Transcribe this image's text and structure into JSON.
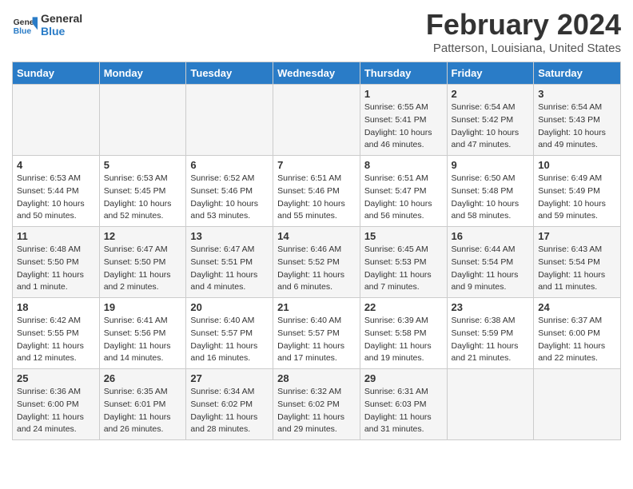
{
  "header": {
    "logo_line1": "General",
    "logo_line2": "Blue",
    "month": "February 2024",
    "location": "Patterson, Louisiana, United States"
  },
  "days_of_week": [
    "Sunday",
    "Monday",
    "Tuesday",
    "Wednesday",
    "Thursday",
    "Friday",
    "Saturday"
  ],
  "weeks": [
    [
      {
        "day": "",
        "sunrise": "",
        "sunset": "",
        "daylight": ""
      },
      {
        "day": "",
        "sunrise": "",
        "sunset": "",
        "daylight": ""
      },
      {
        "day": "",
        "sunrise": "",
        "sunset": "",
        "daylight": ""
      },
      {
        "day": "",
        "sunrise": "",
        "sunset": "",
        "daylight": ""
      },
      {
        "day": "1",
        "sunrise": "Sunrise: 6:55 AM",
        "sunset": "Sunset: 5:41 PM",
        "daylight": "Daylight: 10 hours and 46 minutes."
      },
      {
        "day": "2",
        "sunrise": "Sunrise: 6:54 AM",
        "sunset": "Sunset: 5:42 PM",
        "daylight": "Daylight: 10 hours and 47 minutes."
      },
      {
        "day": "3",
        "sunrise": "Sunrise: 6:54 AM",
        "sunset": "Sunset: 5:43 PM",
        "daylight": "Daylight: 10 hours and 49 minutes."
      }
    ],
    [
      {
        "day": "4",
        "sunrise": "Sunrise: 6:53 AM",
        "sunset": "Sunset: 5:44 PM",
        "daylight": "Daylight: 10 hours and 50 minutes."
      },
      {
        "day": "5",
        "sunrise": "Sunrise: 6:53 AM",
        "sunset": "Sunset: 5:45 PM",
        "daylight": "Daylight: 10 hours and 52 minutes."
      },
      {
        "day": "6",
        "sunrise": "Sunrise: 6:52 AM",
        "sunset": "Sunset: 5:46 PM",
        "daylight": "Daylight: 10 hours and 53 minutes."
      },
      {
        "day": "7",
        "sunrise": "Sunrise: 6:51 AM",
        "sunset": "Sunset: 5:46 PM",
        "daylight": "Daylight: 10 hours and 55 minutes."
      },
      {
        "day": "8",
        "sunrise": "Sunrise: 6:51 AM",
        "sunset": "Sunset: 5:47 PM",
        "daylight": "Daylight: 10 hours and 56 minutes."
      },
      {
        "day": "9",
        "sunrise": "Sunrise: 6:50 AM",
        "sunset": "Sunset: 5:48 PM",
        "daylight": "Daylight: 10 hours and 58 minutes."
      },
      {
        "day": "10",
        "sunrise": "Sunrise: 6:49 AM",
        "sunset": "Sunset: 5:49 PM",
        "daylight": "Daylight: 10 hours and 59 minutes."
      }
    ],
    [
      {
        "day": "11",
        "sunrise": "Sunrise: 6:48 AM",
        "sunset": "Sunset: 5:50 PM",
        "daylight": "Daylight: 11 hours and 1 minute."
      },
      {
        "day": "12",
        "sunrise": "Sunrise: 6:47 AM",
        "sunset": "Sunset: 5:50 PM",
        "daylight": "Daylight: 11 hours and 2 minutes."
      },
      {
        "day": "13",
        "sunrise": "Sunrise: 6:47 AM",
        "sunset": "Sunset: 5:51 PM",
        "daylight": "Daylight: 11 hours and 4 minutes."
      },
      {
        "day": "14",
        "sunrise": "Sunrise: 6:46 AM",
        "sunset": "Sunset: 5:52 PM",
        "daylight": "Daylight: 11 hours and 6 minutes."
      },
      {
        "day": "15",
        "sunrise": "Sunrise: 6:45 AM",
        "sunset": "Sunset: 5:53 PM",
        "daylight": "Daylight: 11 hours and 7 minutes."
      },
      {
        "day": "16",
        "sunrise": "Sunrise: 6:44 AM",
        "sunset": "Sunset: 5:54 PM",
        "daylight": "Daylight: 11 hours and 9 minutes."
      },
      {
        "day": "17",
        "sunrise": "Sunrise: 6:43 AM",
        "sunset": "Sunset: 5:54 PM",
        "daylight": "Daylight: 11 hours and 11 minutes."
      }
    ],
    [
      {
        "day": "18",
        "sunrise": "Sunrise: 6:42 AM",
        "sunset": "Sunset: 5:55 PM",
        "daylight": "Daylight: 11 hours and 12 minutes."
      },
      {
        "day": "19",
        "sunrise": "Sunrise: 6:41 AM",
        "sunset": "Sunset: 5:56 PM",
        "daylight": "Daylight: 11 hours and 14 minutes."
      },
      {
        "day": "20",
        "sunrise": "Sunrise: 6:40 AM",
        "sunset": "Sunset: 5:57 PM",
        "daylight": "Daylight: 11 hours and 16 minutes."
      },
      {
        "day": "21",
        "sunrise": "Sunrise: 6:40 AM",
        "sunset": "Sunset: 5:57 PM",
        "daylight": "Daylight: 11 hours and 17 minutes."
      },
      {
        "day": "22",
        "sunrise": "Sunrise: 6:39 AM",
        "sunset": "Sunset: 5:58 PM",
        "daylight": "Daylight: 11 hours and 19 minutes."
      },
      {
        "day": "23",
        "sunrise": "Sunrise: 6:38 AM",
        "sunset": "Sunset: 5:59 PM",
        "daylight": "Daylight: 11 hours and 21 minutes."
      },
      {
        "day": "24",
        "sunrise": "Sunrise: 6:37 AM",
        "sunset": "Sunset: 6:00 PM",
        "daylight": "Daylight: 11 hours and 22 minutes."
      }
    ],
    [
      {
        "day": "25",
        "sunrise": "Sunrise: 6:36 AM",
        "sunset": "Sunset: 6:00 PM",
        "daylight": "Daylight: 11 hours and 24 minutes."
      },
      {
        "day": "26",
        "sunrise": "Sunrise: 6:35 AM",
        "sunset": "Sunset: 6:01 PM",
        "daylight": "Daylight: 11 hours and 26 minutes."
      },
      {
        "day": "27",
        "sunrise": "Sunrise: 6:34 AM",
        "sunset": "Sunset: 6:02 PM",
        "daylight": "Daylight: 11 hours and 28 minutes."
      },
      {
        "day": "28",
        "sunrise": "Sunrise: 6:32 AM",
        "sunset": "Sunset: 6:02 PM",
        "daylight": "Daylight: 11 hours and 29 minutes."
      },
      {
        "day": "29",
        "sunrise": "Sunrise: 6:31 AM",
        "sunset": "Sunset: 6:03 PM",
        "daylight": "Daylight: 11 hours and 31 minutes."
      },
      {
        "day": "",
        "sunrise": "",
        "sunset": "",
        "daylight": ""
      },
      {
        "day": "",
        "sunrise": "",
        "sunset": "",
        "daylight": ""
      }
    ]
  ]
}
